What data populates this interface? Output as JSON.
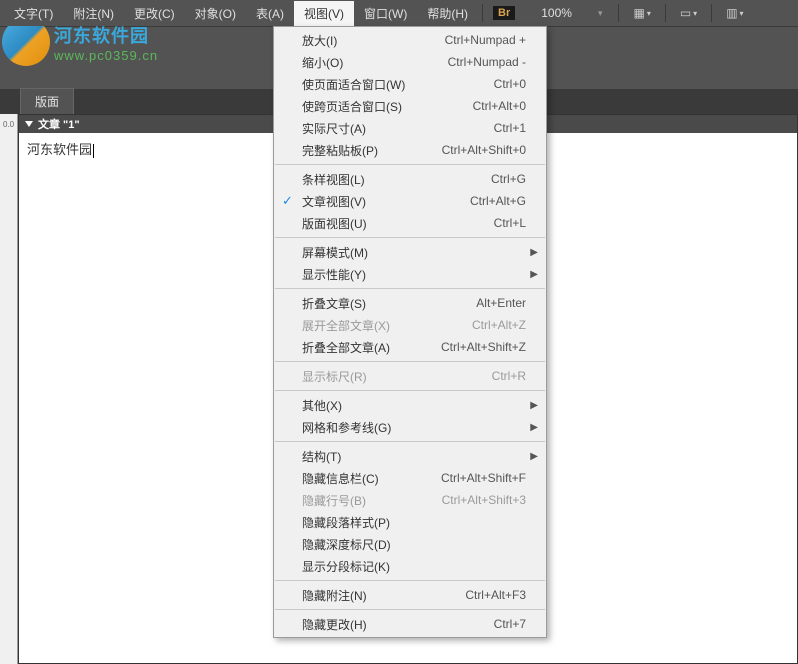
{
  "menubar": {
    "items": [
      {
        "label": "文字(T)"
      },
      {
        "label": "附注(N)"
      },
      {
        "label": "更改(C)"
      },
      {
        "label": "对象(O)"
      },
      {
        "label": "表(A)"
      },
      {
        "label": "视图(V)"
      },
      {
        "label": "窗口(W)"
      },
      {
        "label": "帮助(H)"
      }
    ],
    "br_badge": "Br",
    "zoom": "100%"
  },
  "logo": {
    "line1": "河东软件园",
    "line2": "www.pc0359.cn"
  },
  "tab": {
    "label": "版面"
  },
  "ruler_mark": "0.0",
  "panel": {
    "title": "文章 \"1\"",
    "content": "河东软件园"
  },
  "view_menu": {
    "items": [
      {
        "label": "放大(I)",
        "shortcut": "Ctrl+Numpad +",
        "type": "item"
      },
      {
        "label": "缩小(O)",
        "shortcut": "Ctrl+Numpad -",
        "type": "item"
      },
      {
        "label": "使页面适合窗口(W)",
        "shortcut": "Ctrl+0",
        "type": "item"
      },
      {
        "label": "使跨页适合窗口(S)",
        "shortcut": "Ctrl+Alt+0",
        "type": "item"
      },
      {
        "label": "实际尺寸(A)",
        "shortcut": "Ctrl+1",
        "type": "item"
      },
      {
        "label": "完整粘贴板(P)",
        "shortcut": "Ctrl+Alt+Shift+0",
        "type": "item"
      },
      {
        "type": "sep"
      },
      {
        "label": "条样视图(L)",
        "shortcut": "Ctrl+G",
        "type": "item"
      },
      {
        "label": "文章视图(V)",
        "shortcut": "Ctrl+Alt+G",
        "type": "item",
        "checked": true
      },
      {
        "label": "版面视图(U)",
        "shortcut": "Ctrl+L",
        "type": "item"
      },
      {
        "type": "sep"
      },
      {
        "label": "屏幕模式(M)",
        "type": "item",
        "submenu": true
      },
      {
        "label": "显示性能(Y)",
        "type": "item",
        "submenu": true
      },
      {
        "type": "sep"
      },
      {
        "label": "折叠文章(S)",
        "shortcut": "Alt+Enter",
        "type": "item"
      },
      {
        "label": "展开全部文章(X)",
        "shortcut": "Ctrl+Alt+Z",
        "type": "item",
        "disabled": true
      },
      {
        "label": "折叠全部文章(A)",
        "shortcut": "Ctrl+Alt+Shift+Z",
        "type": "item"
      },
      {
        "type": "sep"
      },
      {
        "label": "显示标尺(R)",
        "shortcut": "Ctrl+R",
        "type": "item",
        "disabled": true
      },
      {
        "type": "sep"
      },
      {
        "label": "其他(X)",
        "type": "item",
        "submenu": true
      },
      {
        "label": "网格和参考线(G)",
        "type": "item",
        "submenu": true
      },
      {
        "type": "sep"
      },
      {
        "label": "结构(T)",
        "type": "item",
        "submenu": true
      },
      {
        "label": "隐藏信息栏(C)",
        "shortcut": "Ctrl+Alt+Shift+F",
        "type": "item"
      },
      {
        "label": "隐藏行号(B)",
        "shortcut": "Ctrl+Alt+Shift+3",
        "type": "item",
        "disabled": true
      },
      {
        "label": "隐藏段落样式(P)",
        "type": "item"
      },
      {
        "label": "隐藏深度标尺(D)",
        "type": "item"
      },
      {
        "label": "显示分段标记(K)",
        "type": "item"
      },
      {
        "type": "sep"
      },
      {
        "label": "隐藏附注(N)",
        "shortcut": "Ctrl+Alt+F3",
        "type": "item"
      },
      {
        "type": "sep"
      },
      {
        "label": "隐藏更改(H)",
        "shortcut": "Ctrl+7",
        "type": "item"
      }
    ]
  }
}
